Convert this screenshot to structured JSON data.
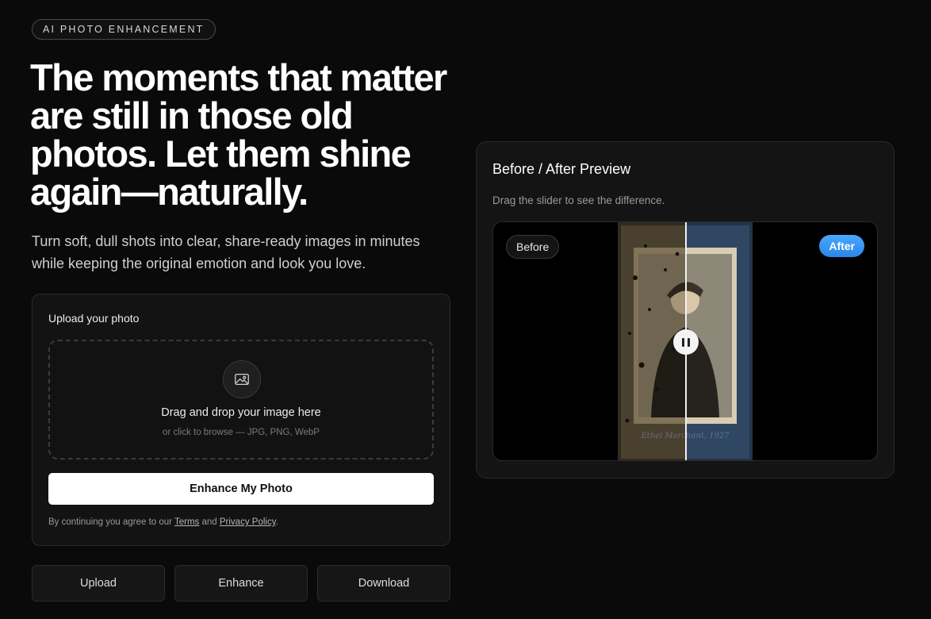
{
  "badge": "AI PHOTO ENHANCEMENT",
  "headline": "The moments that matter are still in those old photos. Let them shine again—naturally.",
  "subtitle": "Turn soft, dull shots into clear, share-ready images in minutes while keeping the original emotion and look you love.",
  "upload": {
    "title": "Upload your photo",
    "drop_main": "Drag and drop your image here",
    "drop_sub": "or click to browse — JPG, PNG, WebP",
    "drop_icon": "image-icon",
    "button": "Enhance My Photo",
    "terms_prefix": "By continuing you agree to our ",
    "terms_link": "Terms",
    "terms_and": " and ",
    "privacy_link": "Privacy Policy",
    "terms_suffix": "."
  },
  "steps": [
    "Upload",
    "Enhance",
    "Download"
  ],
  "preview": {
    "title": "Before / After Preview",
    "subtitle": "Drag the slider to see the difference.",
    "before_label": "Before",
    "after_label": "After",
    "photo_caption": "Ethel Marchant, 1927",
    "slider_handle_icon": "pause-icon",
    "slider_position": 0.5
  },
  "colors": {
    "background": "#0a0a0a",
    "card": "#141414",
    "accent": "#3b99fc",
    "primary_button": "#ffffff"
  }
}
